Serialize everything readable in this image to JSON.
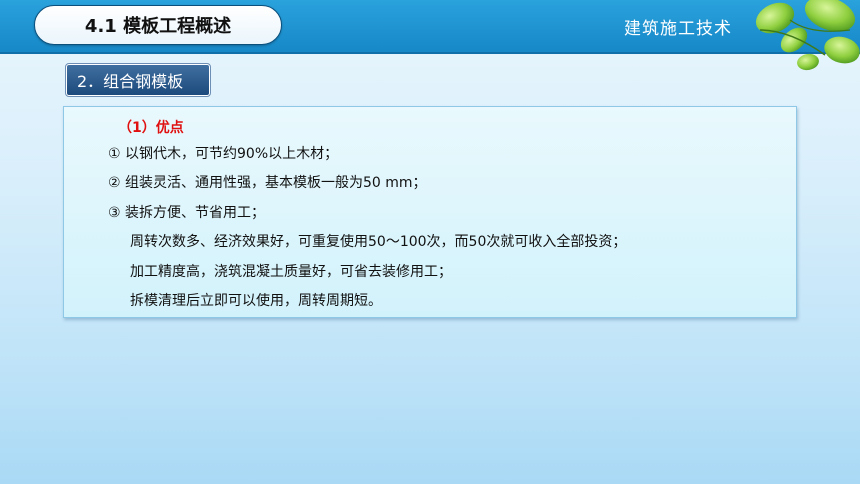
{
  "header": {
    "title": "4.1  模板工程概述",
    "subject": "建筑施工技术"
  },
  "section": {
    "label": "2．组合钢模板"
  },
  "content": {
    "heading": "（1）优点",
    "lines": [
      "① 以钢代木，可节约90%以上木材；",
      "② 组装灵活、通用性强，基本模板一般为50 mm；",
      "③ 装拆方便、节省用工；",
      "周转次数多、经济效果好，可重复使用50～100次，而50次就可收入全部投资；",
      "加工精度高，浇筑混凝土质量好，可省去装修用工；",
      "拆模清理后立即可以使用，周转周期短。"
    ]
  },
  "colors": {
    "header_blue": "#1a8fd0",
    "heading_red": "#e01010",
    "section_blue": "#2a5a8c",
    "leaf_green": "#7cc13a"
  }
}
